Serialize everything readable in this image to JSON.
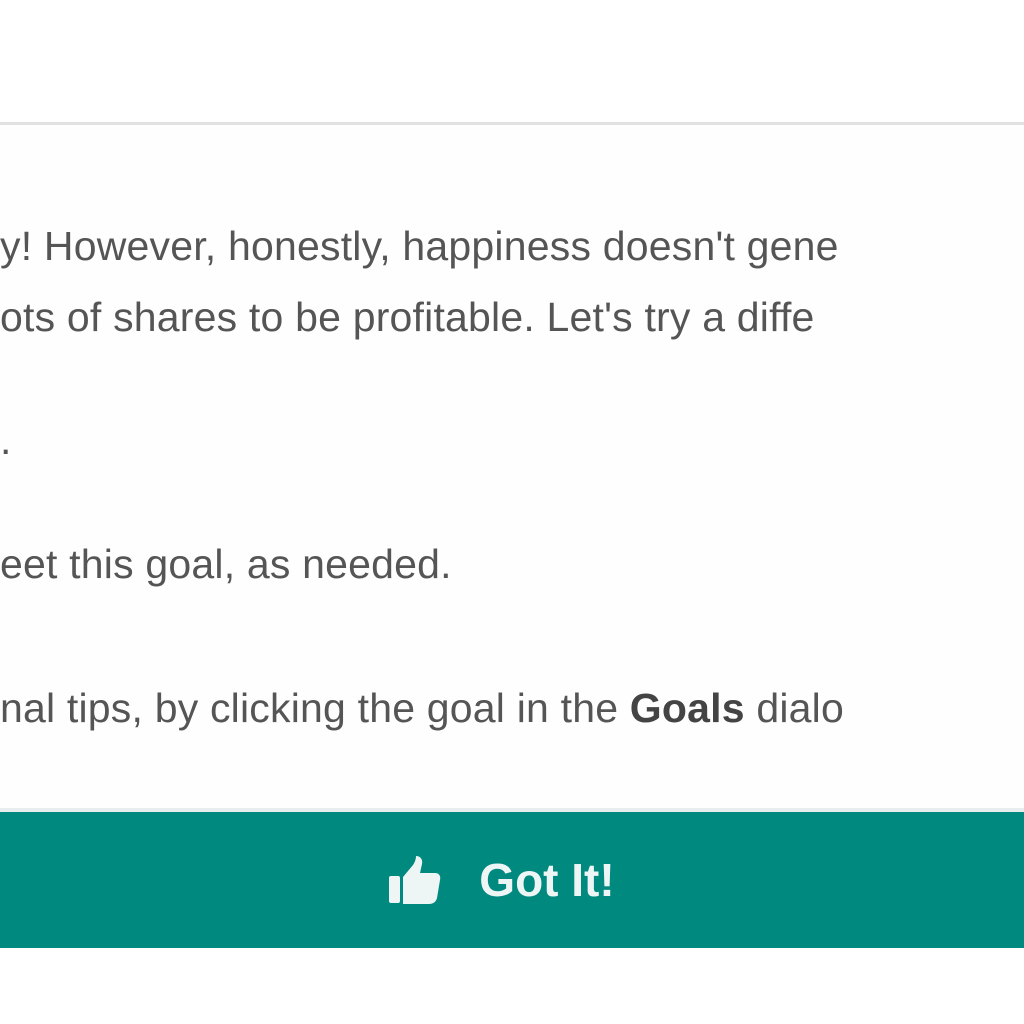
{
  "dialog": {
    "message": {
      "line1": "y! However, honestly, happiness doesn't gene",
      "line2": "ots of shares to be profitable. Let's try a diffe",
      "line3": ".",
      "line4": "eet this goal, as needed.",
      "line5_before": "nal tips, by clicking the goal in the ",
      "line5_bold": "Goals",
      "line5_after": " dialo"
    },
    "button": {
      "label": "Got It!",
      "icon": "thumbs-up-icon"
    }
  },
  "colors": {
    "button_background": "#00897f",
    "button_text": "#eef6f5",
    "body_text": "#555555",
    "divider": "#e2e2e2"
  }
}
